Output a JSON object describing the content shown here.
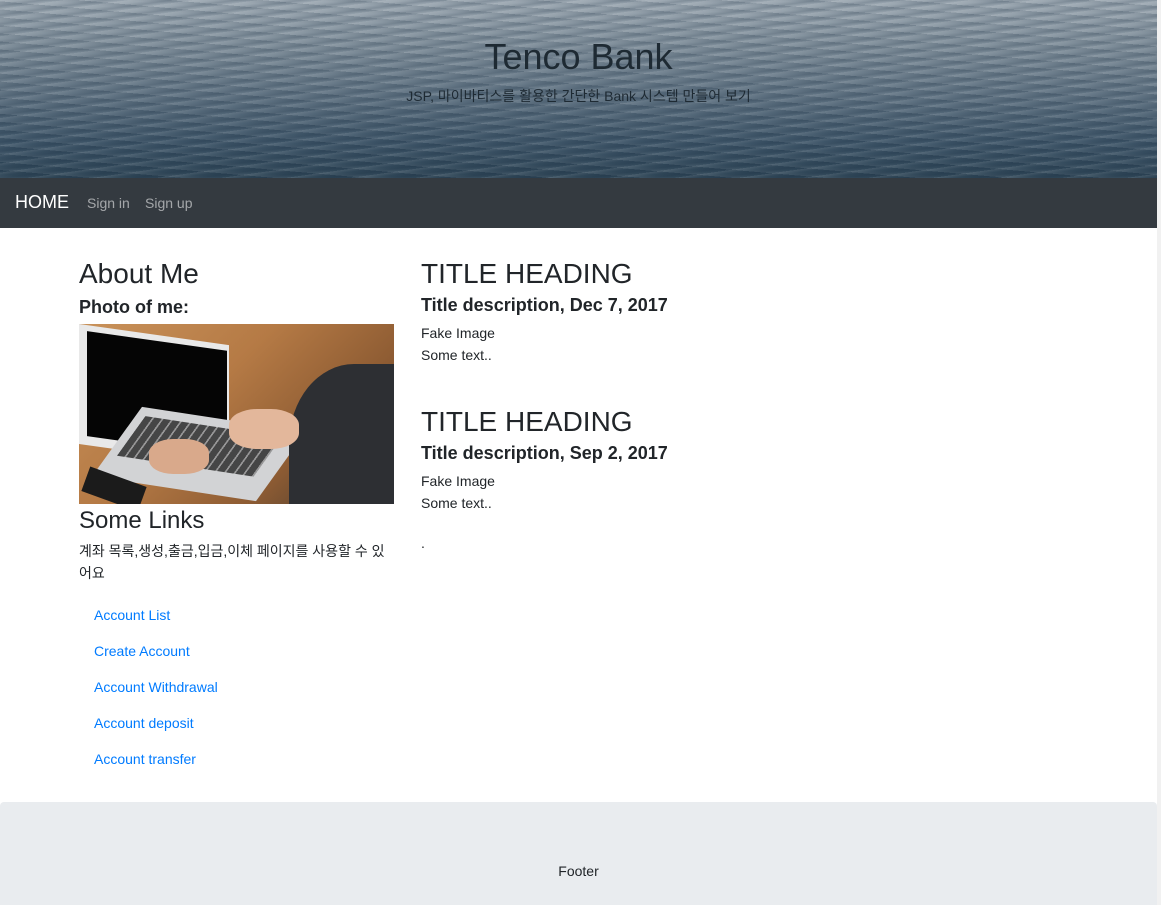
{
  "header": {
    "title": "Tenco Bank",
    "subtitle": "JSP, 마이바티스를 활용한 간단한 Bank 시스템 만들어 보기"
  },
  "navbar": {
    "home": "HOME",
    "sign_in": "Sign in",
    "sign_up": "Sign up"
  },
  "sidebar": {
    "about_title": "About Me",
    "photo_label": "Photo of me:",
    "links_title": "Some Links",
    "links_description": "계좌 목록,생성,출금,입금,이체 페이지를 사용할 수 있어요",
    "links": [
      {
        "label": "Account List"
      },
      {
        "label": "Create Account"
      },
      {
        "label": "Account Withdrawal"
      },
      {
        "label": "Account deposit"
      },
      {
        "label": "Account transfer"
      }
    ]
  },
  "posts": [
    {
      "heading": "TITLE HEADING",
      "description": "Title description, Dec 7, 2017",
      "image_text": "Fake Image",
      "body": "Some text.."
    },
    {
      "heading": "TITLE HEADING",
      "description": "Title description, Sep 2, 2017",
      "image_text": "Fake Image",
      "body": "Some text.."
    }
  ],
  "trailing_text": ".",
  "footer": {
    "text": "Footer"
  }
}
